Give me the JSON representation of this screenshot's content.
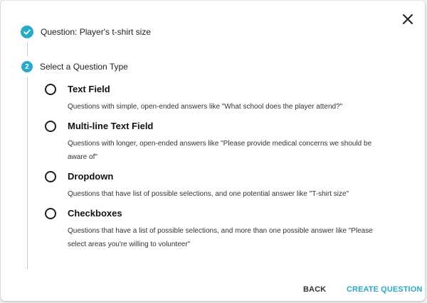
{
  "colors": {
    "accent": "#27a9c8",
    "text": "#222222"
  },
  "close_icon": "close-icon",
  "steps": [
    {
      "status": "completed",
      "icon": "check-icon",
      "label": "Question: Player's t-shirt size"
    },
    {
      "status": "active",
      "number": "2",
      "label": "Select a Question Type"
    }
  ],
  "question_types": [
    {
      "title": "Text Field",
      "description": "Questions with simple, open-ended answers like \"What school does the player attend?\"",
      "selected": false
    },
    {
      "title": "Multi-line Text Field",
      "description": "Questions with longer, open-ended answers like \"Please provide medical concerns we should be aware of\"",
      "selected": false
    },
    {
      "title": "Dropdown",
      "description": "Questions that have list of possible selections, and one potential answer like \"T-shirt size\"",
      "selected": false
    },
    {
      "title": "Checkboxes",
      "description": "Questions that have a list of possible selections, and more than one possible answer like \"Please select areas you're willing to volunteer\"",
      "selected": false
    }
  ],
  "actions": {
    "back_label": "BACK",
    "create_label": "CREATE QUESTION"
  }
}
